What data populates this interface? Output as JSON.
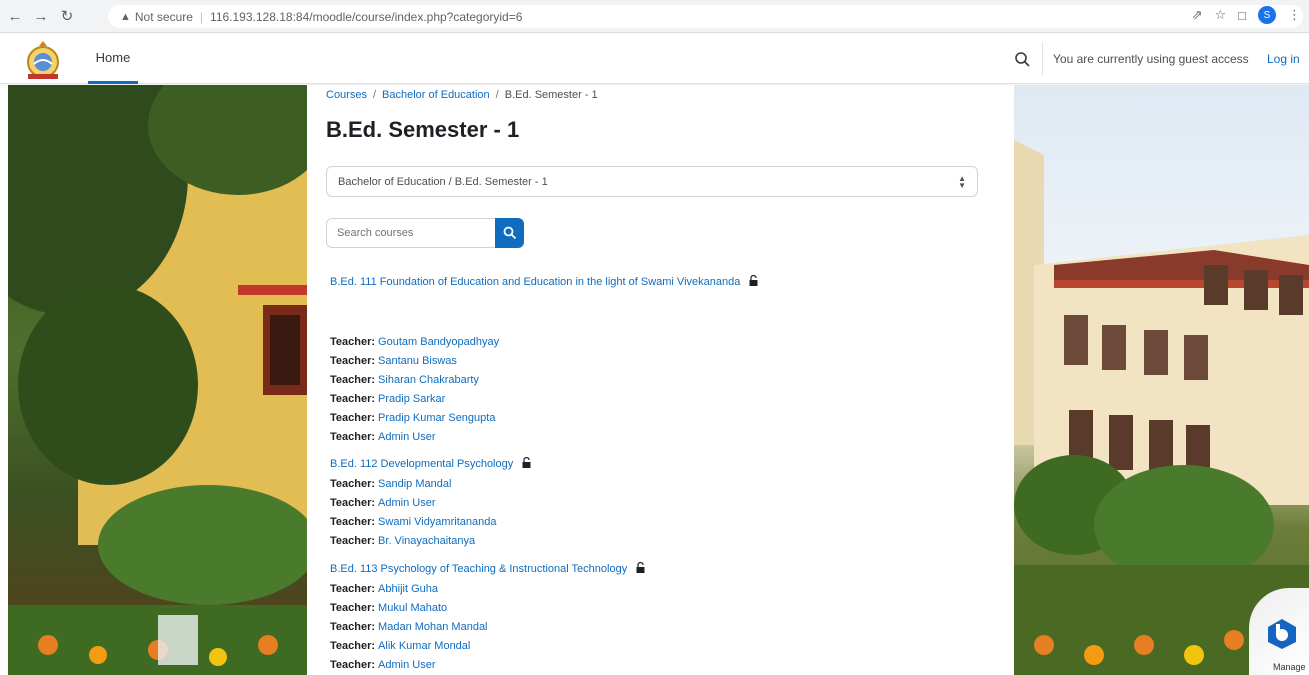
{
  "browser": {
    "security_label": "Not secure",
    "url": "116.193.128.18:84/moodle/course/index.php?categoryid=6",
    "profile_initial": "S"
  },
  "navbar": {
    "home_label": "Home",
    "guest_text": "You are currently using guest access",
    "login_label": "Log in"
  },
  "breadcrumb": [
    "Courses",
    "Bachelor of Education",
    "B.Ed. Semester - 1"
  ],
  "page_title": "B.Ed. Semester - 1",
  "category_select": "Bachelor of Education / B.Ed. Semester - 1",
  "search": {
    "placeholder": "Search courses"
  },
  "teacher_label": "Teacher:",
  "courses": [
    {
      "title": "B.Ed. 111 Foundation of Education and Education in the light of Swami Vivekananda",
      "teachers": [
        "Goutam Bandyopadhyay",
        "Santanu Biswas",
        "Siharan Chakrabarty",
        "Pradip Sarkar",
        "Pradip Kumar Sengupta",
        "Admin User"
      ]
    },
    {
      "title": "B.Ed. 112 Developmental Psychology",
      "teachers": [
        "Sandip Mandal",
        "Admin User",
        "Swami Vidyamritananda",
        "Br. Vinayachaitanya"
      ]
    },
    {
      "title": "B.Ed. 113 Psychology of Teaching & Instructional Technology",
      "teachers": [
        "Abhijit Guha",
        "Mukul Mahato",
        "Madan Mohan Mandal",
        "Alik Kumar Mondal",
        "Admin User"
      ]
    }
  ],
  "manage_badge": "Manage",
  "colors": {
    "accent": "#0f6cbf",
    "text": "#1d2125"
  }
}
